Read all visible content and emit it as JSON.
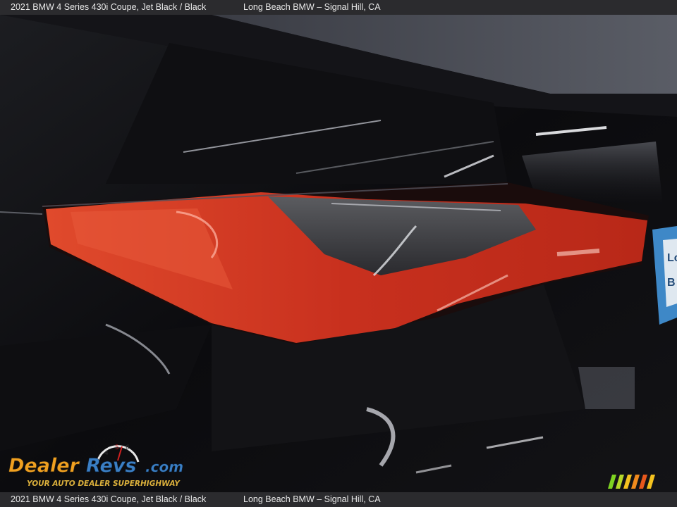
{
  "caption": {
    "vehicle": "2021 BMW 4 Series 430i Coupe,   Jet Black  /  Black",
    "dealer": "Long Beach BMW – Signal Hill, CA"
  },
  "watermark": {
    "brand": "DealerRevs.com",
    "tagline": "YOUR AUTO DEALER SUPERHIGHWAY"
  },
  "colors": {
    "paint": "#0b0b0d",
    "taillight": "#d43a22",
    "caption_bar": "#2b2b2e",
    "watermark_orange": "#f0a020",
    "watermark_blue": "#3b7fc4"
  },
  "stripe_colors": [
    "#7dd321",
    "#b6d82a",
    "#f4c21f",
    "#f08a1d",
    "#e8581c",
    "#f4c21f"
  ]
}
